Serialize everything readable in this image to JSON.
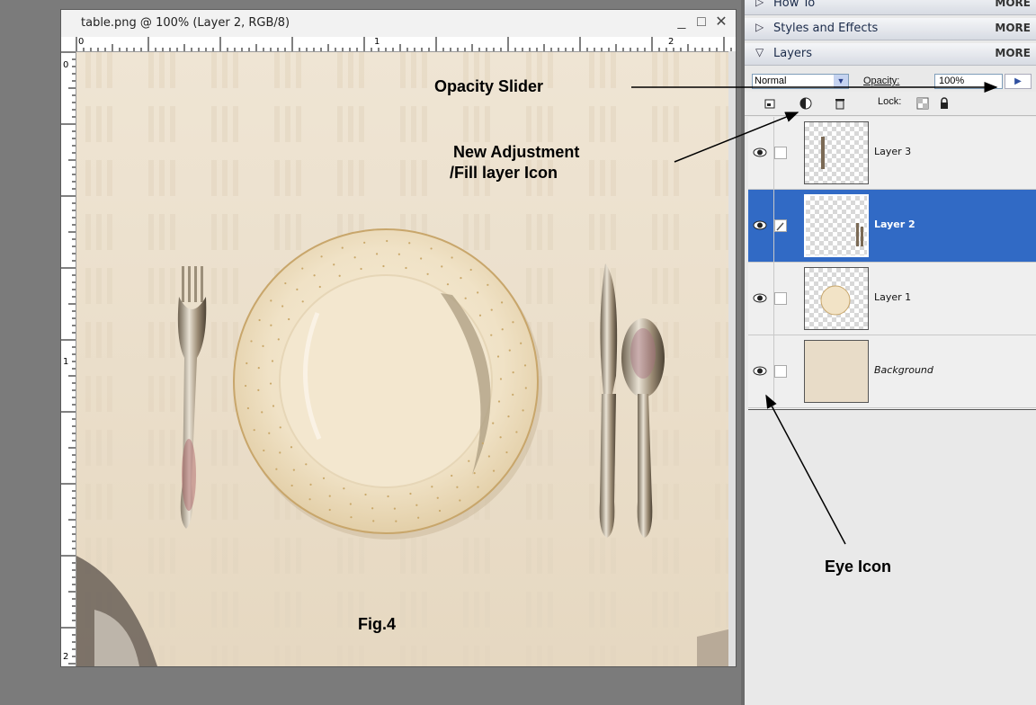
{
  "document": {
    "title": "table.png @ 100% (Layer 2, RGB/8)",
    "minimize_glyph": "_",
    "maximize_glyph": "□",
    "close_glyph": "✕",
    "ruler_top_numbers": [
      "0",
      "1",
      "2"
    ],
    "ruler_left_numbers": [
      "0",
      "1",
      "2"
    ]
  },
  "panel": {
    "sections": [
      {
        "label": "How To",
        "more": "MORE",
        "expanded": false
      },
      {
        "label": "Styles and Effects",
        "more": "MORE",
        "expanded": false
      },
      {
        "label": "Layers",
        "more": "MORE",
        "expanded": true
      }
    ],
    "blend_mode": "Normal",
    "opacity_label": "Opacity:",
    "opacity_value": "100%",
    "lock_label": "Lock:",
    "layers": [
      {
        "name": "Layer 3",
        "selected": false
      },
      {
        "name": "Layer 2",
        "selected": true
      },
      {
        "name": "Layer 1",
        "selected": false
      },
      {
        "name": "Background",
        "selected": false
      }
    ]
  },
  "annotations": {
    "opacity_slider": "Opacity Slider",
    "new_adjustment_line1": "New Adjustment",
    "new_adjustment_line2": "/Fill layer Icon",
    "eye_icon": "Eye Icon",
    "figure_label": "Fig.4"
  },
  "colors": {
    "selection_blue": "#316ac5",
    "workspace_gray": "#7b7b7b",
    "tablecloth": "#ece1cf"
  }
}
